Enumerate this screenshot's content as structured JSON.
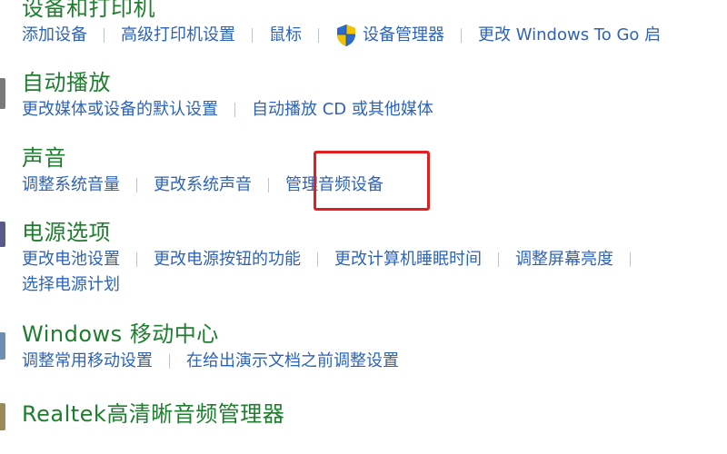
{
  "sections": {
    "devices": {
      "title": "设备和打印机",
      "links": [
        "添加设备",
        "高级打印机设置",
        "鼠标",
        "设备管理器",
        "更改 Windows To Go 启"
      ]
    },
    "autoplay": {
      "title": "自动播放",
      "links": [
        "更改媒体或设备的默认设置",
        "自动播放 CD 或其他媒体"
      ]
    },
    "sound": {
      "title": "声音",
      "links": [
        "调整系统音量",
        "更改系统声音",
        "管理音频设备"
      ]
    },
    "power": {
      "title": "电源选项",
      "links": [
        "更改电池设置",
        "更改电源按钮的功能",
        "更改计算机睡眠时间",
        "调整屏幕亮度",
        "选择电源计划"
      ]
    },
    "mobility": {
      "title": "Windows 移动中心",
      "links": [
        "调整常用移动设置",
        "在给出演示文档之前调整设置"
      ]
    },
    "realtek": {
      "title": "Realtek高清晰音频管理器"
    }
  },
  "colors": {
    "title_green": "#1e7d2e",
    "link_blue": "#2d63b8",
    "highlight_red": "#e02020"
  },
  "icons": {
    "device_manager": "uac-shield-icon"
  }
}
